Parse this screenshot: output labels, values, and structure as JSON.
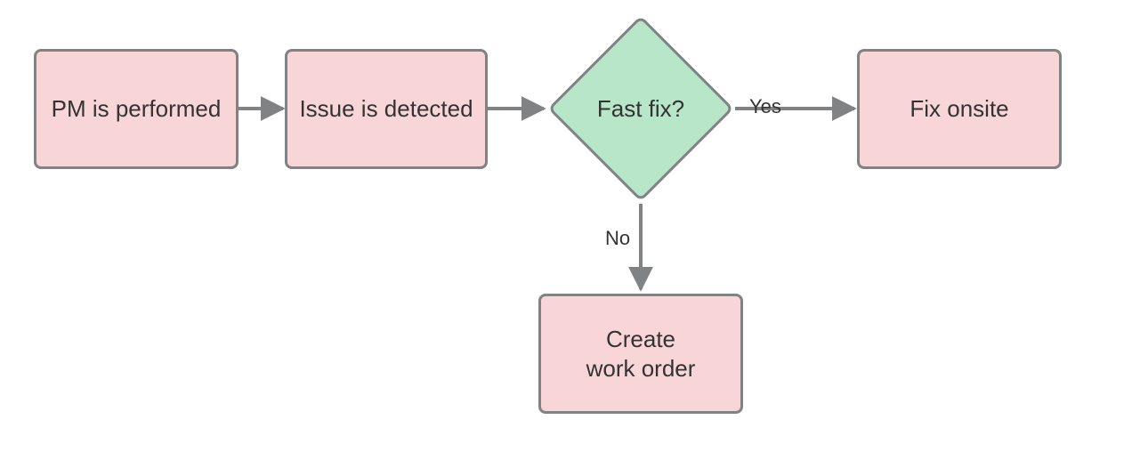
{
  "nodes": {
    "pm": {
      "label": "PM is performed"
    },
    "issue": {
      "label": "Issue is detected"
    },
    "decision": {
      "label": "Fast fix?"
    },
    "fix": {
      "label": "Fix onsite"
    },
    "workorder": {
      "label": "Create\nwork order"
    }
  },
  "edges": {
    "yes": {
      "label": "Yes"
    },
    "no": {
      "label": "No"
    }
  },
  "colors": {
    "pink_fill": "#F8D5D6",
    "green_fill": "#B8E6C8",
    "stroke": "#808284",
    "text": "#333333"
  }
}
